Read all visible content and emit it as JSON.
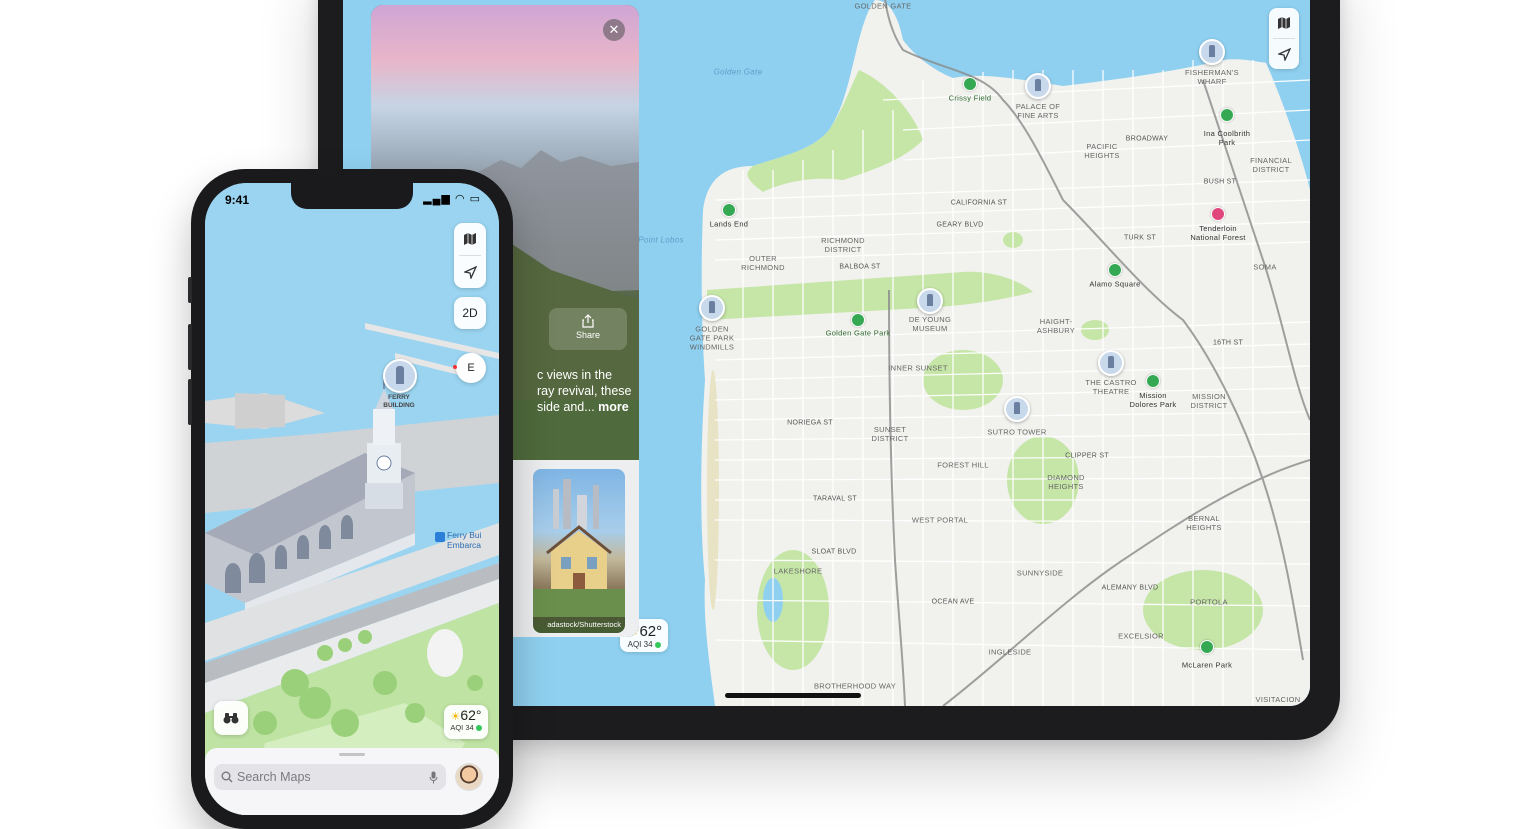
{
  "ipad": {
    "place_card": {
      "close_glyph": "✕",
      "share_label": "Share",
      "description_lines": [
        "c views in the",
        "ray revival, these",
        "side and..."
      ],
      "more_link": "more",
      "photo_credit": "adastock/Shutterstock"
    },
    "controls": {
      "map_icon": "map-icon",
      "location_icon": "location-arrow-icon"
    },
    "weather": {
      "temp": "62°",
      "aqi": "AQI 34"
    },
    "map_labels": {
      "golden_gate": "GOLDEN GATE",
      "golden_gate_water": "Golden\nGate",
      "crissy_field": "Crissy Field",
      "palace_fine_arts": "PALACE OF\nFINE ARTS",
      "fishermans_wharf": "FISHERMAN'S\nWHARF",
      "ina_coolbrith": "Ina Coolbrith\nPark",
      "financial_district": "FINANCIAL\nDISTRICT",
      "pacific_heights": "PACIFIC\nHEIGHTS",
      "lands_end": "Lands End",
      "point_lobos": "Point Lobos",
      "richmond_district": "RICHMOND\nDISTRICT",
      "outer_richmond": "OUTER\nRICHMOND",
      "tenderloin_forest": "Tenderloin\nNational Forest",
      "alamo_square": "Alamo Square",
      "golden_gate_park": "Golden Gate Park",
      "de_young": "DE YOUNG\nMUSEUM",
      "golden_gate_windmills": "GOLDEN\nGATE PARK\nWINDMILLS",
      "haight_ashbury": "HAIGHT-\nASHBURY",
      "inner_sunset": "INNER SUNSET",
      "castro_theatre": "THE CASTRO\nTHEATRE",
      "mission_dolores": "Mission\nDolores Park",
      "mission_district": "MISSION\nDISTRICT",
      "sutro_tower": "SUTRO TOWER",
      "sunset_district": "SUNSET\nDISTRICT",
      "forest_hill": "FOREST HILL",
      "diamond_heights": "DIAMOND\nHEIGHTS",
      "west_portal": "WEST PORTAL",
      "bernal_heights": "BERNAL\nHEIGHTS",
      "lakeshore": "LAKESHORE",
      "sunnyside": "SUNNYSIDE",
      "ingleside": "INGLESIDE",
      "excelsior": "EXCELSIOR",
      "portola": "PORTOLA",
      "mclaren_park": "McLaren Park",
      "brotherhood_way": "BROTHERHOOD WAY",
      "visitacion": "VISITACION\nVALLEY",
      "california_st": "CALIFORNIA ST",
      "geary_blvd": "GEARY BLVD",
      "balboa_st": "BALBOA ST",
      "noriega_st": "NORIEGA ST",
      "taraval_st": "TARAVAL ST",
      "sloat_blvd": "SLOAT BLVD",
      "ocean_ave": "OCEAN AVE",
      "soma": "SOMA",
      "bush_st": "BUSH ST",
      "broadway": "BROADWAY",
      "turk_st": "TURK ST",
      "clipper_st": "CLIPPER ST",
      "sixteenth_st": "16TH ST",
      "alemany_blvd": "ALEMANY BLVD"
    }
  },
  "iphone": {
    "status": {
      "time": "9:41",
      "icons": "▂▄▆ ◠ ▭"
    },
    "controls": {
      "map_icon": "map-icon",
      "location_icon": "location-arrow-icon",
      "view_mode": "2D",
      "compass": "E"
    },
    "ferry_label": "FERRY\nBUILDING",
    "transit_label": "Ferry Bui\nEmbarca",
    "weather": {
      "temp": "62°",
      "aqi": "AQI 34"
    },
    "search": {
      "placeholder": "Search Maps"
    }
  },
  "colors": {
    "water": "#8fd0f0",
    "land": "#f1f1ee",
    "park": "#c6e6a8",
    "road": "#ffffff",
    "highway": "#8a8a8a"
  }
}
